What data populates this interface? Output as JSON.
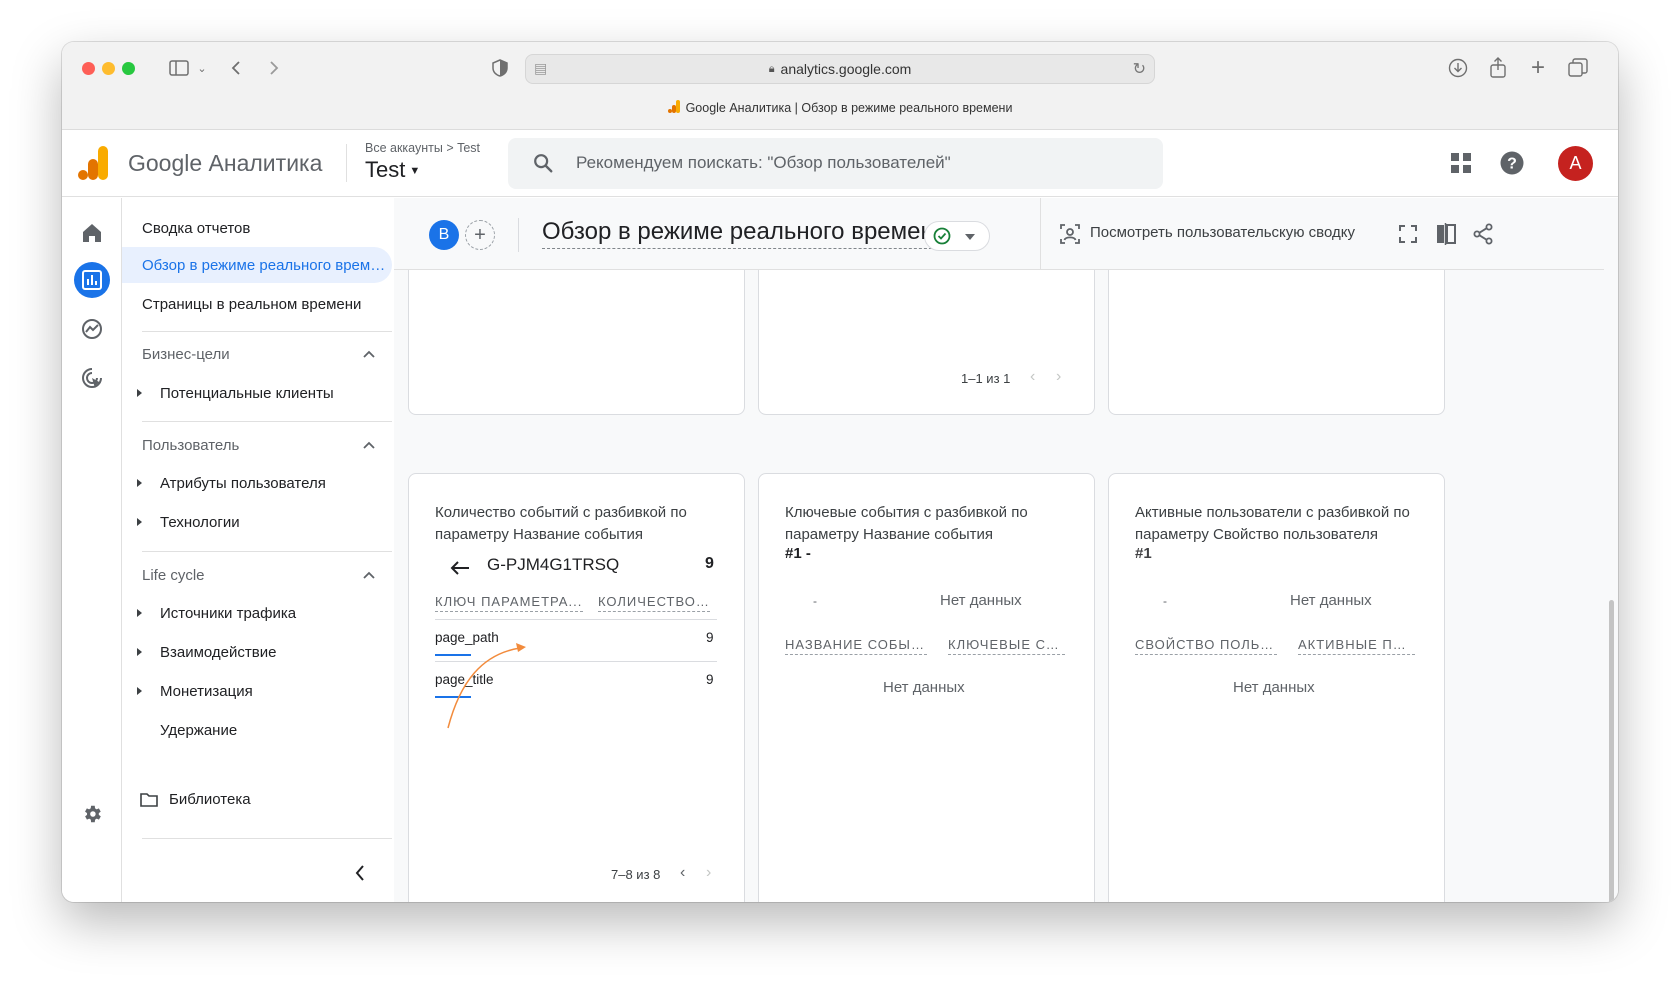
{
  "browser": {
    "url": "analytics.google.com",
    "tab_title": "Google Аналитика | Обзор в режиме реального времени"
  },
  "header": {
    "brand": "Google Аналитика",
    "breadcrumb": "Все аккаунты > Test",
    "account": "Test",
    "search_placeholder": "Рекомендуем поискать: \"Обзор пользователей\"",
    "avatar_letter": "A"
  },
  "nav": {
    "reports_snapshot": "Сводка отчетов",
    "realtime_overview": "Обзор в режиме реального времени",
    "realtime_pages": "Страницы в реальном времени",
    "sections": [
      {
        "title": "Бизнес-цели",
        "items": [
          "Потенциальные клиенты"
        ]
      },
      {
        "title": "Пользователь",
        "items": [
          "Атрибуты пользователя",
          "Технологии"
        ]
      },
      {
        "title": "Life cycle",
        "items": [
          "Источники трафика",
          "Взаимодействие",
          "Монетизация",
          "Удержание"
        ]
      }
    ],
    "library": "Библиотека"
  },
  "toolbar": {
    "comparison_letter": "B",
    "page_title": "Обзор в режиме реального времени",
    "view_user_snapshot": "Посмотреть пользовательскую сводку"
  },
  "top_cards": {
    "pager": "1–1 из 1"
  },
  "cards": [
    {
      "title": "Количество событий с разбивкой по параметру Название события",
      "drill_value": "G-PJM4G1TRSQ",
      "drill_count": "9",
      "col1": "КЛЮЧ ПАРАМЕТРА...",
      "col2": "КОЛИЧЕСТВО ...",
      "rows": [
        {
          "key": "page_path",
          "value": "9"
        },
        {
          "key": "page_title",
          "value": "9"
        }
      ],
      "pager": "7–8 из 8"
    },
    {
      "title": "Ключевые события с разбивкой по параметру Название события",
      "rank": "#1  -",
      "dash": "-",
      "no_data": "Нет данных",
      "col1": "НАЗВАНИЕ СОБЫТ...",
      "col2": "КЛЮЧЕВЫЕ СО...",
      "table_no_data": "Нет данных"
    },
    {
      "title": "Активные пользователи с разбивкой по параметру Свойство пользователя",
      "rank": "#1",
      "dash": "-",
      "no_data": "Нет данных",
      "col1": "СВОЙСТВО ПОЛЬЗ...",
      "col2": "АКТИВНЫЕ ПО...",
      "table_no_data": "Нет данных"
    }
  ],
  "colors": {
    "accent": "#1a73e8",
    "avatar": "#c5221f",
    "ga_orange": "#f9ab00",
    "ga_dark_orange": "#e37400",
    "annotation_arrow": "#f28b3c"
  }
}
